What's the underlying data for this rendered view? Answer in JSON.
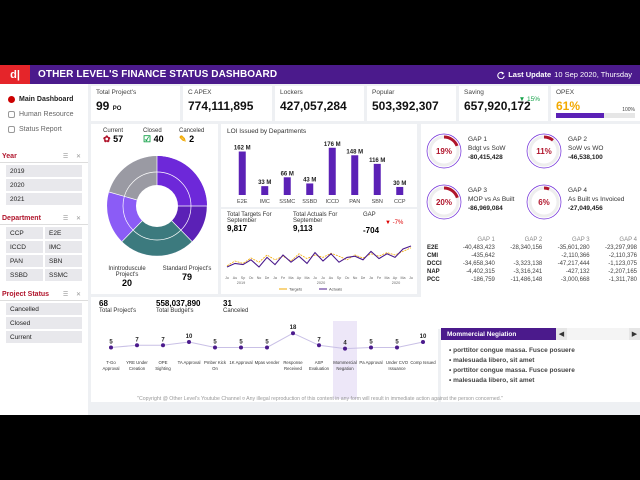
{
  "header": {
    "logo_text": "d|",
    "title": "OTHER LEVEL'S FINANCE STATUS DASHBOARD",
    "update_label": "Last Update",
    "update_value": "10 Sep 2020, Thursday"
  },
  "sidebar": {
    "nav": [
      {
        "label": "Main Dashboard",
        "active": true
      },
      {
        "label": "Human Resource",
        "active": false
      },
      {
        "label": "Status Report",
        "active": false
      }
    ],
    "year": {
      "title": "Year",
      "items": [
        "2019",
        "2020",
        "2021"
      ]
    },
    "department": {
      "title": "Department",
      "items": [
        "CCP",
        "E2E",
        "ICCD",
        "IMC",
        "PAN",
        "SBN",
        "SSBD",
        "SSMC"
      ]
    },
    "project_status": {
      "title": "Project Status",
      "items": [
        "Cancelled",
        "Closed",
        "Current"
      ]
    }
  },
  "kpis": [
    {
      "label": "Total Project's",
      "value": "99",
      "suffix": "PO"
    },
    {
      "label": "C APEX",
      "value": "774,111,895"
    },
    {
      "label": "Lockers",
      "value": "427,057,284"
    },
    {
      "label": "Popular",
      "value": "503,392,307"
    },
    {
      "label": "Saving",
      "value": "657,920,172",
      "change": "15%"
    },
    {
      "label": "OPEX",
      "value": "61%",
      "max": "100%",
      "fill": 0.61
    }
  ],
  "donut_panel": {
    "current_label": "Current",
    "current_value": "57",
    "closed_label": "Closed",
    "closed_value": "40",
    "canceled_label": "Canceled",
    "canceled_value": "2",
    "intro_label": "Inintroduscule Project's",
    "intro_value": "20",
    "standard_label": "Standard Project's",
    "standard_value": "79"
  },
  "loi_chart": {
    "title": "LOI Issued by Departments",
    "chart_data": {
      "type": "bar",
      "categories": [
        "E2E",
        "IMC",
        "SSMC",
        "SSBD",
        "ICCD",
        "PAN",
        "SBN",
        "CCP"
      ],
      "values": [
        162,
        33,
        66,
        43,
        176,
        148,
        116,
        30
      ],
      "labels": [
        "162 M",
        "33 M",
        "66 M",
        "43 M",
        "176 M",
        "148 M",
        "116 M",
        "30 M"
      ],
      "ylim": [
        0,
        190
      ]
    }
  },
  "targets": {
    "target_label": "Total Targets For September",
    "target_value": "9,817",
    "actual_label": "Total Actuals For September",
    "actual_value": "9,113",
    "gap_label": "GAP",
    "gap_change": "-7%",
    "gap_value": "-704",
    "legend_targets": "Targets",
    "legend_actuals": "Actuals",
    "x_ticks": [
      "Ju",
      "Au",
      "Sp",
      "Oc",
      "No",
      "De",
      "Ja",
      "Fe",
      "Ma",
      "Ap",
      "Ma",
      "Ju",
      "Ju",
      "Au",
      "Sp",
      "Oc",
      "No",
      "De",
      "Ja",
      "Fe",
      "Ma",
      "Ap",
      "Ma",
      "Ju"
    ],
    "year_labels": [
      "2019",
      "2020",
      "2020"
    ],
    "chart_data": {
      "type": "line",
      "series": [
        {
          "name": "Targets",
          "values": [
            42,
            50,
            46,
            55,
            48,
            60,
            52,
            58,
            50,
            62,
            54,
            60,
            56,
            63,
            58,
            52,
            60,
            55,
            62,
            58,
            64,
            60,
            66,
            72
          ]
        },
        {
          "name": "Actuals",
          "values": [
            40,
            46,
            44,
            52,
            40,
            56,
            44,
            60,
            48,
            58,
            46,
            64,
            50,
            62,
            48,
            56,
            58,
            52,
            66,
            54,
            62,
            56,
            70,
            75
          ]
        }
      ],
      "ylim": [
        30,
        80
      ]
    }
  },
  "gaps": [
    {
      "pct": "19%",
      "fill": 0.19,
      "name": "GAP 1",
      "desc": "Bdgt vs SoW",
      "value": "-80,415,428"
    },
    {
      "pct": "11%",
      "fill": 0.11,
      "name": "GAP 2",
      "desc": "SoW vs WO",
      "value": "-46,538,100"
    },
    {
      "pct": "20%",
      "fill": 0.2,
      "name": "GAP 3",
      "desc": "MOP vs As Built",
      "value": "-86,969,084"
    },
    {
      "pct": "6%",
      "fill": 0.06,
      "name": "GAP 4",
      "desc": "As Built vs Invoiced",
      "value": "-27,049,456"
    }
  ],
  "gap_table": {
    "headers": [
      "",
      "GAP 1",
      "GAP 2",
      "GAP 3",
      "GAP 4"
    ],
    "rows": [
      [
        "E2E",
        "-40,483,423",
        "-28,340,156",
        "-35,601,280",
        "-23,297,998"
      ],
      [
        "CMI",
        "-435,642",
        "",
        "-2,110,366",
        "-2,110,376"
      ],
      [
        "DCCI",
        "-34,658,340",
        "-3,323,138",
        "-47,217,444",
        "-1,123,075"
      ],
      [
        "NAP",
        "-4,402,315",
        "-3,316,241",
        "-427,132",
        "-2,207,165"
      ],
      [
        "PCC",
        "-186,759",
        "-11,486,148",
        "-3,000,668",
        "-1,311,780"
      ]
    ]
  },
  "bottom": {
    "total_projects": "68",
    "total_projects_label": "Total Project's",
    "total_budget": "558,037,890",
    "total_budget_label": "Total Budget's",
    "canceled": "31",
    "canceled_label": "Canceled",
    "chart_data": {
      "type": "line",
      "categories": [
        "T-Go Approval",
        "YRE Under Creation",
        "OPE Sighting",
        "TA Approval",
        "Pmber Kick On",
        "1K Approval",
        "Mpas vender",
        "Response Received",
        "ASP Evaluation",
        "Mommercial Negation",
        "Pa Approval",
        "Under CVO Issuance",
        "Comp Issued"
      ],
      "values": [
        5,
        7,
        7,
        10,
        5,
        5,
        5,
        18,
        7,
        4,
        5,
        5,
        10
      ],
      "highlight": "Mommercial Negation"
    }
  },
  "negotiation": {
    "title": "Mommercial Negiation",
    "prev": "◀",
    "next": "▶",
    "items": [
      "porttitor congue massa. Fusce posuere",
      "malesuada libero, sit amet",
      "porttitor congue massa. Fusce posuere",
      "malesuada libero, sit amet"
    ]
  },
  "footer": {
    "copyright": "\"Copyright @ Other Level's Youtube Channel ¤ Any illegal reproduction of this content in any form will result in immediate action against the person concerned.\""
  },
  "colors": {
    "purple": "#4b1a8c",
    "violet": "#6d28d9",
    "teal": "#3c7a7e",
    "gray": "#9a9aa3",
    "red": "#b0142b"
  }
}
